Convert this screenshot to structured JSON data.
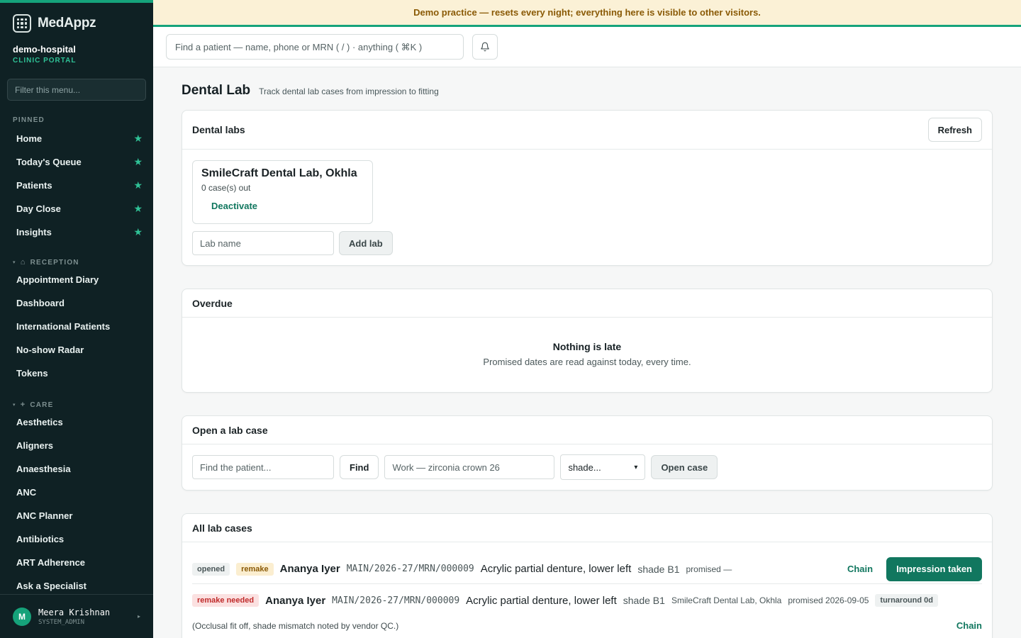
{
  "brand": {
    "name": "MedAppz"
  },
  "org": {
    "name": "demo-hospital",
    "subtitle": "CLINIC PORTAL"
  },
  "sidebar": {
    "filter_placeholder": "Filter this menu...",
    "pinned_label": "PINNED",
    "pinned": [
      {
        "label": "Home"
      },
      {
        "label": "Today's Queue"
      },
      {
        "label": "Patients"
      },
      {
        "label": "Day Close"
      },
      {
        "label": "Insights"
      }
    ],
    "reception_label": "RECEPTION",
    "reception": [
      {
        "label": "Appointment Diary"
      },
      {
        "label": "Dashboard"
      },
      {
        "label": "International Patients"
      },
      {
        "label": "No-show Radar"
      },
      {
        "label": "Tokens"
      }
    ],
    "care_label": "CARE",
    "care": [
      {
        "label": "Aesthetics"
      },
      {
        "label": "Aligners"
      },
      {
        "label": "Anaesthesia"
      },
      {
        "label": "ANC"
      },
      {
        "label": "ANC Planner"
      },
      {
        "label": "Antibiotics"
      },
      {
        "label": "ART Adherence"
      },
      {
        "label": "Ask a Specialist"
      }
    ],
    "user": {
      "initial": "M",
      "name": "Meera Krishnan",
      "role": "SYSTEM_ADMIN"
    }
  },
  "banner": {
    "text": "Demo practice — resets every night; everything here is visible to other visitors."
  },
  "topbar": {
    "search_placeholder": "Find a patient — name, phone or MRN ( / ) · anything ( ⌘K )"
  },
  "page": {
    "title": "Dental Lab",
    "subtitle": "Track dental lab cases from impression to fitting"
  },
  "labs_card": {
    "title": "Dental labs",
    "refresh_label": "Refresh",
    "lab": {
      "name": "SmileCraft Dental Lab, Okhla",
      "count": "0 case(s) out",
      "action": "Deactivate"
    },
    "lab_name_placeholder": "Lab name",
    "add_label": "Add lab"
  },
  "overdue_card": {
    "title": "Overdue",
    "empty_title": "Nothing is late",
    "empty_sub": "Promised dates are read against today, every time."
  },
  "open_card": {
    "title": "Open a lab case",
    "patient_placeholder": "Find the patient...",
    "find_label": "Find",
    "work_placeholder": "Work — zirconia crown 26",
    "shade_selected": "shade...",
    "open_label": "Open case"
  },
  "cases_card": {
    "title": "All lab cases",
    "case1": {
      "status": "opened",
      "flag": "remake",
      "patient": "Ananya Iyer",
      "mrn": "MAIN/2026-27/MRN/000009",
      "work": "Acrylic partial denture, lower left",
      "shade": "shade B1",
      "promised": "promised —",
      "chain_label": "Chain",
      "action_label": "Impression taken"
    },
    "case2": {
      "status": "remake needed",
      "patient": "Ananya Iyer",
      "mrn": "MAIN/2026-27/MRN/000009",
      "work": "Acrylic partial denture, lower left",
      "shade": "shade B1",
      "lab": "SmileCraft Dental Lab, Okhla",
      "promised": "promised 2026-09-05",
      "turnaround": "turnaround 0d",
      "note": "(Occlusal fit off, shade mismatch noted by vendor QC.)",
      "chain_label": "Chain"
    }
  }
}
